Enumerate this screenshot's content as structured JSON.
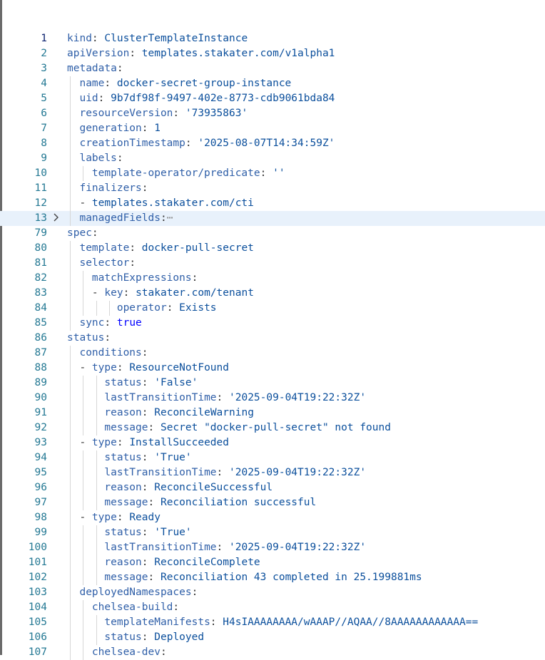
{
  "editor": {
    "lines": [
      {
        "n": "1",
        "active": true,
        "indent": 0,
        "dash": false,
        "key": "kind",
        "value": "ClusterTemplateInstance",
        "vtype": "val"
      },
      {
        "n": "2",
        "indent": 0,
        "dash": false,
        "key": "apiVersion",
        "value": "templates.stakater.com/v1alpha1",
        "vtype": "val"
      },
      {
        "n": "3",
        "indent": 0,
        "dash": false,
        "key": "metadata",
        "value": "",
        "vtype": "val"
      },
      {
        "n": "4",
        "indent": 1,
        "dash": false,
        "key": "name",
        "value": "docker-secret-group-instance",
        "vtype": "val"
      },
      {
        "n": "5",
        "indent": 1,
        "dash": false,
        "key": "uid",
        "value": "9b7df98f-9497-402e-8773-cdb9061bda84",
        "vtype": "val"
      },
      {
        "n": "6",
        "indent": 1,
        "dash": false,
        "key": "resourceVersion",
        "value": "'73935863'",
        "vtype": "str"
      },
      {
        "n": "7",
        "indent": 1,
        "dash": false,
        "key": "generation",
        "value": "1",
        "vtype": "val"
      },
      {
        "n": "8",
        "indent": 1,
        "dash": false,
        "key": "creationTimestamp",
        "value": "'2025-08-07T14:34:59Z'",
        "vtype": "str"
      },
      {
        "n": "9",
        "indent": 1,
        "dash": false,
        "key": "labels",
        "value": "",
        "vtype": "val"
      },
      {
        "n": "10",
        "indent": 2,
        "dash": false,
        "key": "template-operator/predicate",
        "value": "''",
        "vtype": "str"
      },
      {
        "n": "11",
        "indent": 1,
        "dash": false,
        "key": "finalizers",
        "value": "",
        "vtype": "val"
      },
      {
        "n": "12",
        "indent": 2,
        "dash": true,
        "key": "",
        "value": "templates.stakater.com/cti",
        "vtype": "val"
      },
      {
        "n": "13",
        "indent": 1,
        "dash": false,
        "key": "managedFields",
        "value": "",
        "vtype": "val",
        "folded": true,
        "highlight": true
      },
      {
        "n": "79",
        "indent": 0,
        "dash": false,
        "key": "spec",
        "value": "",
        "vtype": "val"
      },
      {
        "n": "80",
        "indent": 1,
        "dash": false,
        "key": "template",
        "value": "docker-pull-secret",
        "vtype": "val"
      },
      {
        "n": "81",
        "indent": 1,
        "dash": false,
        "key": "selector",
        "value": "",
        "vtype": "val"
      },
      {
        "n": "82",
        "indent": 2,
        "dash": false,
        "key": "matchExpressions",
        "value": "",
        "vtype": "val"
      },
      {
        "n": "83",
        "indent": 3,
        "dash": true,
        "key": "key",
        "value": "stakater.com/tenant",
        "vtype": "val"
      },
      {
        "n": "84",
        "indent": 4,
        "dash": false,
        "key": "operator",
        "value": "Exists",
        "vtype": "val"
      },
      {
        "n": "85",
        "indent": 1,
        "dash": false,
        "key": "sync",
        "value": "true",
        "vtype": "bool"
      },
      {
        "n": "86",
        "indent": 0,
        "dash": false,
        "key": "status",
        "value": "",
        "vtype": "val"
      },
      {
        "n": "87",
        "indent": 1,
        "dash": false,
        "key": "conditions",
        "value": "",
        "vtype": "val"
      },
      {
        "n": "88",
        "indent": 2,
        "dash": true,
        "key": "type",
        "value": "ResourceNotFound",
        "vtype": "val"
      },
      {
        "n": "89",
        "indent": 3,
        "dash": false,
        "key": "status",
        "value": "'False'",
        "vtype": "str"
      },
      {
        "n": "90",
        "indent": 3,
        "dash": false,
        "key": "lastTransitionTime",
        "value": "'2025-09-04T19:22:32Z'",
        "vtype": "str"
      },
      {
        "n": "91",
        "indent": 3,
        "dash": false,
        "key": "reason",
        "value": "ReconcileWarning",
        "vtype": "val"
      },
      {
        "n": "92",
        "indent": 3,
        "dash": false,
        "key": "message",
        "value": "Secret \"docker-pull-secret\" not found",
        "vtype": "val"
      },
      {
        "n": "93",
        "indent": 2,
        "dash": true,
        "key": "type",
        "value": "InstallSucceeded",
        "vtype": "val"
      },
      {
        "n": "94",
        "indent": 3,
        "dash": false,
        "key": "status",
        "value": "'True'",
        "vtype": "str"
      },
      {
        "n": "95",
        "indent": 3,
        "dash": false,
        "key": "lastTransitionTime",
        "value": "'2025-09-04T19:22:32Z'",
        "vtype": "str"
      },
      {
        "n": "96",
        "indent": 3,
        "dash": false,
        "key": "reason",
        "value": "ReconcileSuccessful",
        "vtype": "val"
      },
      {
        "n": "97",
        "indent": 3,
        "dash": false,
        "key": "message",
        "value": "Reconciliation successful",
        "vtype": "val"
      },
      {
        "n": "98",
        "indent": 2,
        "dash": true,
        "key": "type",
        "value": "Ready",
        "vtype": "val"
      },
      {
        "n": "99",
        "indent": 3,
        "dash": false,
        "key": "status",
        "value": "'True'",
        "vtype": "str"
      },
      {
        "n": "100",
        "indent": 3,
        "dash": false,
        "key": "lastTransitionTime",
        "value": "'2025-09-04T19:22:32Z'",
        "vtype": "str"
      },
      {
        "n": "101",
        "indent": 3,
        "dash": false,
        "key": "reason",
        "value": "ReconcileComplete",
        "vtype": "val"
      },
      {
        "n": "102",
        "indent": 3,
        "dash": false,
        "key": "message",
        "value": "Reconciliation 43 completed in 25.199881ms",
        "vtype": "val"
      },
      {
        "n": "103",
        "indent": 1,
        "dash": false,
        "key": "deployedNamespaces",
        "value": "",
        "vtype": "val"
      },
      {
        "n": "104",
        "indent": 2,
        "dash": false,
        "key": "chelsea-build",
        "value": "",
        "vtype": "val"
      },
      {
        "n": "105",
        "indent": 3,
        "dash": false,
        "key": "templateManifests",
        "value": "H4sIAAAAAAAA/wAAAP//AQAA//8AAAAAAAAAAAA==",
        "vtype": "val"
      },
      {
        "n": "106",
        "indent": 3,
        "dash": false,
        "key": "status",
        "value": "Deployed",
        "vtype": "val"
      },
      {
        "n": "107",
        "indent": 2,
        "dash": false,
        "key": "chelsea-dev",
        "value": "",
        "vtype": "val"
      }
    ],
    "fold_icon": "chevron-right-icon",
    "ellipsis_glyph": "⋯",
    "colors": {
      "key": "#2f5fa8",
      "value": "#0b4f9c",
      "boolean": "#0000ff",
      "line_number": "#237893",
      "active_line_number": "#0b216f",
      "highlight_bg": "#e8f1fb",
      "indent_guide": "#d6d6d6"
    }
  }
}
